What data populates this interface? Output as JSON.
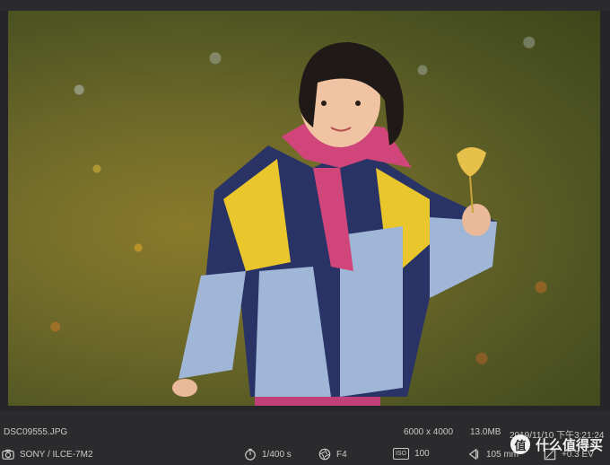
{
  "image": {
    "description_icon": "photo-preview"
  },
  "info": {
    "filename": "DSC09555.JPG",
    "dimensions": "6000 x 4000",
    "filesize": "13.0MB",
    "datetime": "2019/11/10 下午3:21:24"
  },
  "meta": {
    "camera": "SONY / ILCE-7M2",
    "shutter": "1/400 s",
    "aperture": "F4",
    "iso_label": "ISO",
    "iso": "100",
    "focal": "105 mm",
    "ev": "+0.3 EV"
  },
  "watermark": {
    "badge": "值",
    "text": "什么值得买"
  },
  "colors": {
    "background": "#2b2b2d",
    "text": "#c9c9c9"
  }
}
